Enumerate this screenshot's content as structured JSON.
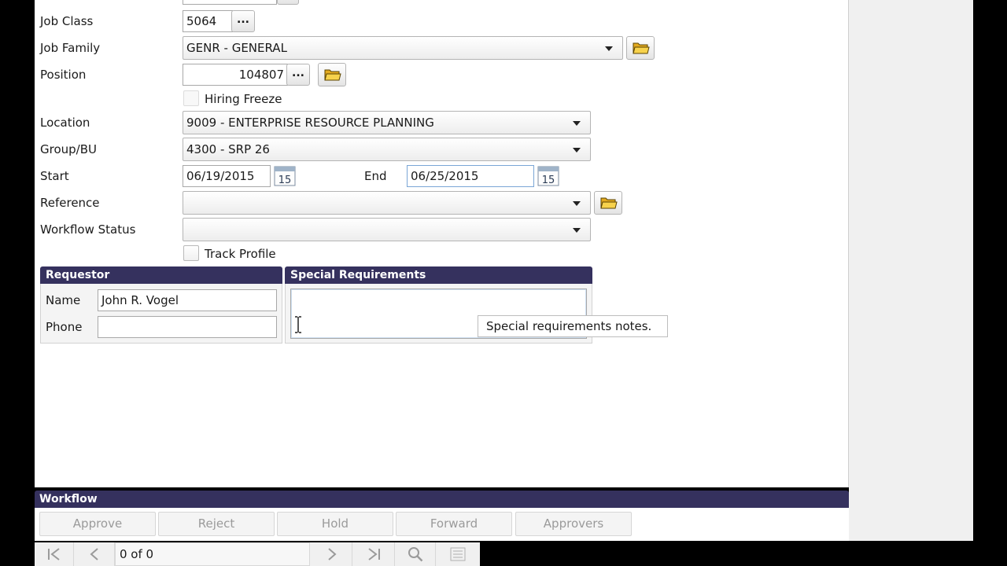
{
  "form": {
    "job_class": {
      "label": "Job Class",
      "value": "5064",
      "lookup_label": "..."
    },
    "job_family": {
      "label": "Job Family",
      "value": "GENR - GENERAL"
    },
    "position": {
      "label": "Position",
      "value": "104807",
      "lookup_label": "..."
    },
    "hiring_freeze": {
      "label": "Hiring Freeze",
      "checked": false
    },
    "location": {
      "label": "Location",
      "value": "9009 - ENTERPRISE RESOURCE PLANNING"
    },
    "group_bu": {
      "label": "Group/BU",
      "value": "4300 - SRP 26"
    },
    "start": {
      "label": "Start",
      "value": "06/19/2015",
      "calendar_day": "15"
    },
    "end": {
      "label": "End",
      "value": "06/25/2015",
      "calendar_day": "15"
    },
    "reference": {
      "label": "Reference",
      "value": ""
    },
    "workflow_status": {
      "label": "Workflow Status",
      "value": ""
    },
    "track_profile": {
      "label": "Track Profile",
      "checked": false
    }
  },
  "requestor": {
    "title": "Requestor",
    "name_label": "Name",
    "name_value": "John R. Vogel",
    "phone_label": "Phone",
    "phone_value": ""
  },
  "special_requirements": {
    "title": "Special Requirements",
    "value": "",
    "tooltip": "Special requirements notes."
  },
  "workflow": {
    "title": "Workflow",
    "buttons": [
      "Approve",
      "Reject",
      "Hold",
      "Forward",
      "Approvers"
    ]
  },
  "navigation": {
    "record_counter": "0 of 0",
    "icons": [
      "first-record-icon",
      "previous-record-icon",
      "next-record-icon",
      "last-record-icon",
      "search-icon",
      "list-icon"
    ]
  },
  "colors": {
    "section_header": "#35315e",
    "folder_icon": "#f2c230"
  }
}
